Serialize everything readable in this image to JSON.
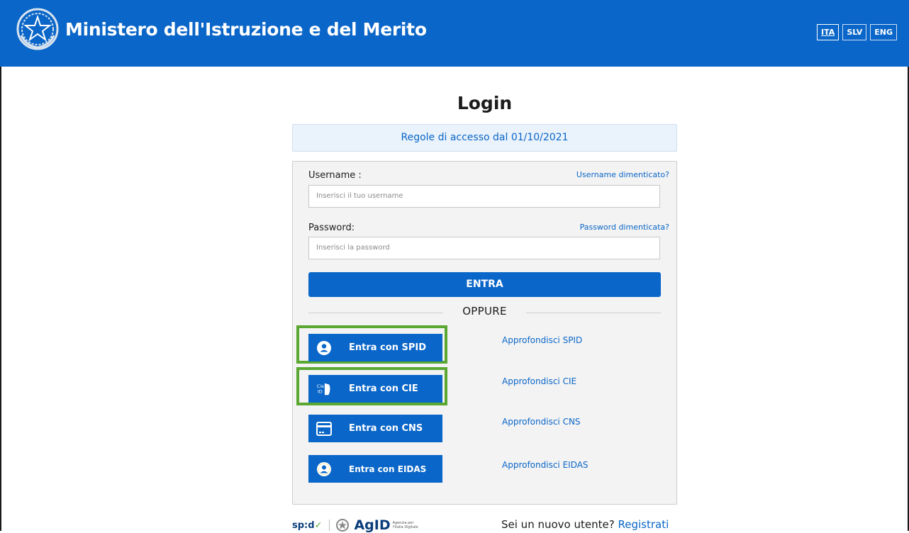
{
  "header": {
    "title": "Ministero dell'Istruzione e del Merito",
    "emblem_icon": "italian-republic-emblem-icon",
    "languages": [
      {
        "label": "ITA",
        "active": true
      },
      {
        "label": "SLV",
        "active": false
      },
      {
        "label": "ENG",
        "active": false
      }
    ]
  },
  "login": {
    "title": "Login",
    "rules_link": "Regole di accesso dal 01/10/2021",
    "username_label": "Username :",
    "username_forgot": "Username dimenticato?",
    "username_placeholder": "Inserisci il tuo username",
    "password_label": "Password:",
    "password_forgot": "Password dimenticata?",
    "password_placeholder": "Inserisci la password",
    "enter_button": "ENTRA",
    "or_label": "OPPURE"
  },
  "auth_options": [
    {
      "label": "Entra con SPID",
      "icon": "user-circle-icon",
      "more": "Approfondisci SPID",
      "highlighted": true
    },
    {
      "label": "Entra con CIE",
      "icon": "cie-id-icon",
      "more": "Approfondisci CIE",
      "highlighted": true
    },
    {
      "label": "Entra con CNS",
      "icon": "card-icon",
      "more": "Approfondisci CNS",
      "highlighted": false
    },
    {
      "label": "Entra con EIDAS",
      "icon": "eu-user-icon",
      "more": "Approfondisci EIDAS",
      "highlighted": false
    }
  ],
  "footer": {
    "spid_logo": "sp:d",
    "agid_logo": "AgID",
    "agid_sub_1": "Agenzia per",
    "agid_sub_2": "l'Italia Digitale",
    "new_user_text": "Sei un nuovo utente?",
    "register_link": "Registrati"
  },
  "colors": {
    "primary": "#0a66c8",
    "highlight": "#5aa832",
    "panel_bg": "#f3f3f3"
  }
}
